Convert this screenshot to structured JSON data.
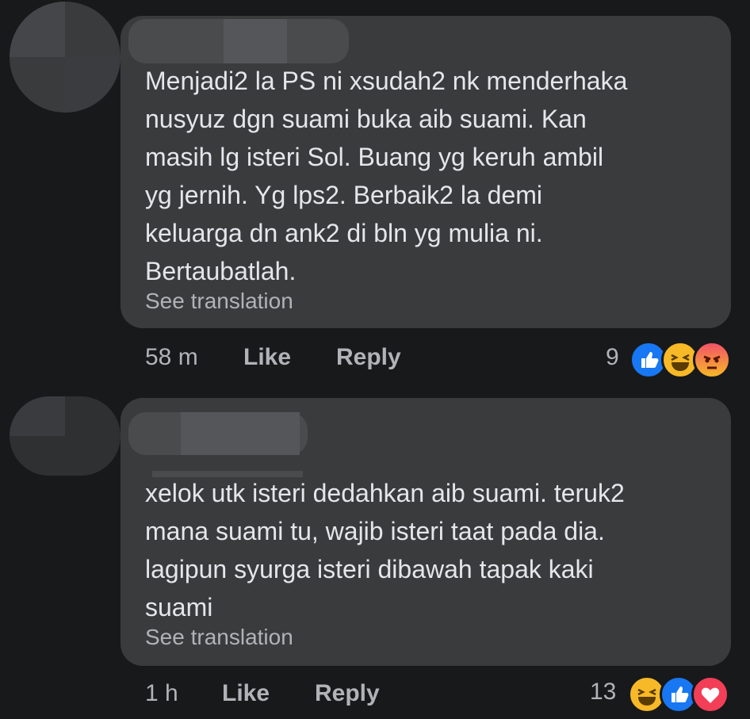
{
  "comments": [
    {
      "text": "Menjadi2 la PS ni xsudah2 nk menderhaka\nnusyuz dgn suami buka aib suami. Kan\nmasih lg isteri Sol. Buang yg keruh ambil\nyg jernih. Yg lps2. Berbaik2 la demi\nkeluarga dn ank2 di bln yg mulia ni.\nBertaubatlah.",
      "see_translation": "See translation",
      "time": "58 m",
      "like_label": "Like",
      "reply_label": "Reply",
      "reaction_count": "9",
      "reaction_icons": [
        "like-icon",
        "haha-icon",
        "angry-icon"
      ]
    },
    {
      "text": "xelok utk isteri dedahkan aib suami. teruk2\nmana suami tu, wajib isteri taat pada dia.\nlagipun syurga isteri dibawah tapak kaki\nsuami",
      "see_translation": "See translation",
      "time": "1 h",
      "like_label": "Like",
      "reply_label": "Reply",
      "reaction_count": "13",
      "reaction_icons": [
        "haha-icon",
        "like-icon",
        "love-icon"
      ]
    }
  ],
  "colors": {
    "background": "#18191a",
    "bubble": "#3a3b3c",
    "text": "#e4e6eb",
    "secondary_text": "#b0b3b8",
    "like": "#1877f2",
    "haha": "#f7b928",
    "love": "#f33e58"
  }
}
